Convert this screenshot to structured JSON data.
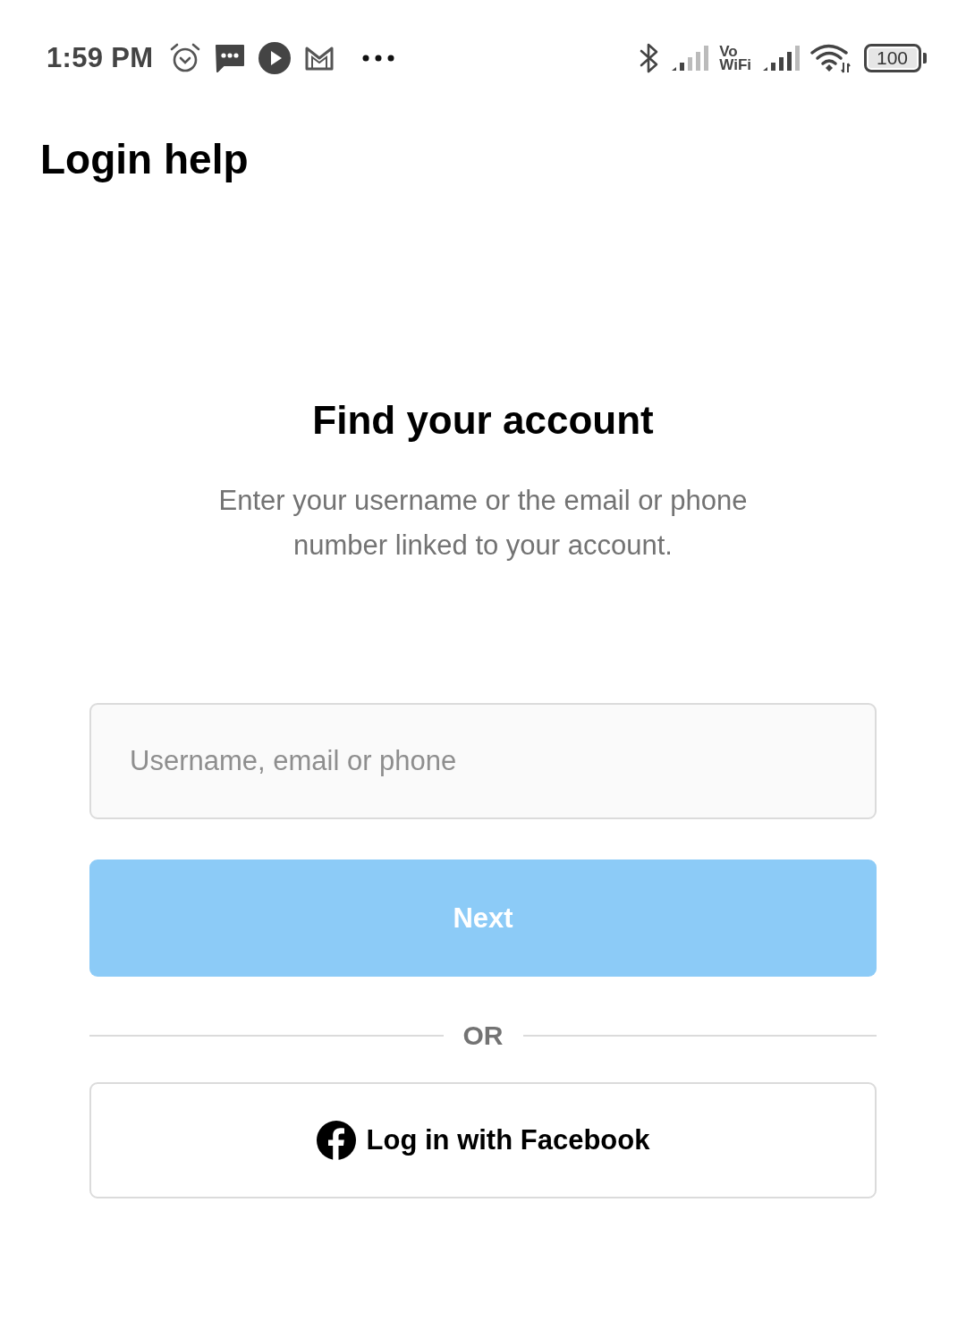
{
  "status_bar": {
    "time": "1:59 PM",
    "network_label": [
      "Vo",
      "WiFi"
    ],
    "battery": "100"
  },
  "header": {
    "title": "Login help"
  },
  "main": {
    "heading": "Find your account",
    "description": "Enter your username or the email or phone number linked to your account.",
    "input": {
      "placeholder": "Username, email or phone"
    },
    "next_button": {
      "label": "Next",
      "disabled": true
    },
    "divider": {
      "label": "OR"
    },
    "facebook_button": {
      "label": "Log in with Facebook"
    }
  }
}
